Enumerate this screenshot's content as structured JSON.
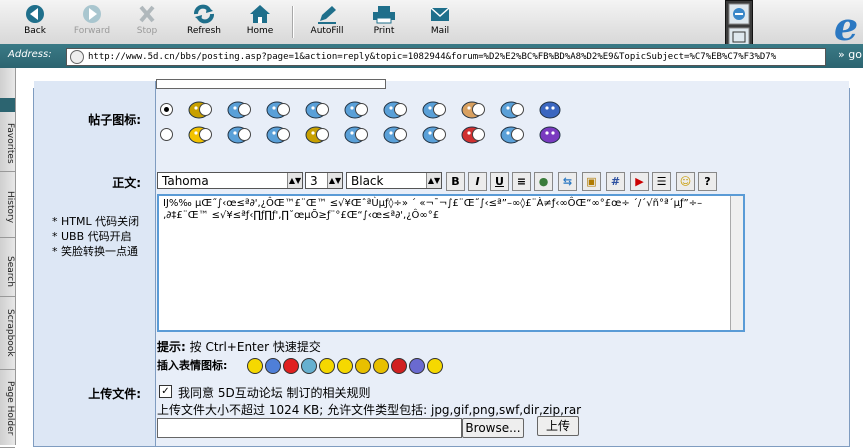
{
  "toolbar": {
    "back": "Back",
    "forward": "Forward",
    "stop": "Stop",
    "refresh": "Refresh",
    "home": "Home",
    "autofill": "AutoFill",
    "print": "Print",
    "mail": "Mail"
  },
  "address": {
    "label": "Address:",
    "url": "http://www.5d.cn/bbs/posting.asp?page=1&action=reply&topic=1082944&forum=%D2%E2%BC%FB%BD%A8%D2%E9&TopicSubject=%C7%EB%C7%F3%D7%",
    "go": "go"
  },
  "sidebar": {
    "tabs": [
      "Favorites",
      "History",
      "Search",
      "Scrapbook",
      "Page Holder"
    ]
  },
  "form": {
    "icon_label": "帖子图标:",
    "body_label": "正文:",
    "options": [
      "* HTML 代码关闭",
      "* UBB  代码开启",
      "* 笑脸转换一点通"
    ],
    "font_name": "Tahoma",
    "font_size": "3",
    "font_color": "Black",
    "body_text": "Ĳ%‰ µŒ˝∫‹œ≤ª∂',¿ÔŒ™£¨Œ™ ≤√¥ŒˆªÙµƒ◊÷» ´ «¬¯¬∫£¨Œ˝∫‹≤ª”–∞◊£¨À≠ƒ‹∞ÔŒ“∞°£œ÷ ´/´√ñ°ª´µƒ”÷–‚∂‡£¨Œ™ ≤√¥≤ªƒ‹∏ƒ∏ƒ',∏˘œµÕ≥ƒ¨°£Œ“∫‹œ≤ª∂',¿Ô∞°£",
    "hint_label": "提示:",
    "hint_text": "按 Ctrl+Enter 快速提交",
    "emoticon_label": "插入表情图标:",
    "upload_label": "上传文件:",
    "agree_text": "我同意 5D互动论坛 制订的相关规则",
    "upload_note": "上传文件大小不超过 1024 KB; 允许文件类型包括: jpg,gif,png,swf,dir,zip,rar",
    "browse_label": "Browse...",
    "upload_button": "上传"
  }
}
